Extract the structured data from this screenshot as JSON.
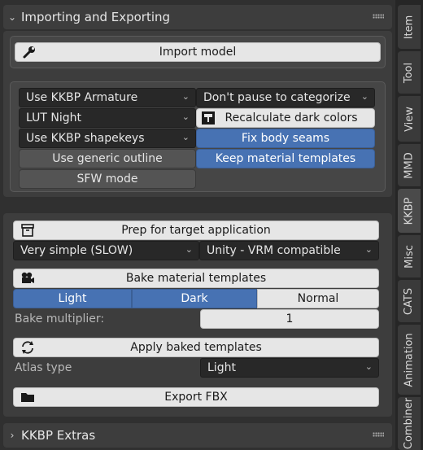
{
  "panel_title": "Importing and Exporting",
  "import_button": "Import model",
  "options": {
    "armature": "Use KKBP Armature",
    "categorize": "Don't pause to categorize",
    "lut": "LUT Night",
    "recalc_dark": "Recalculate dark colors",
    "shapekeys": "Use KKBP shapekeys",
    "fix_seams": "Fix body seams",
    "generic_outline": "Use generic outline",
    "keep_templates": "Keep material templates",
    "sfw": "SFW mode"
  },
  "export": {
    "prep_button": "Prep for target application",
    "simplify": "Very simple (SLOW)",
    "target": "Unity - VRM compatible",
    "bake_button": "Bake material templates",
    "bake_modes": [
      "Light",
      "Dark",
      "Normal"
    ],
    "bake_multiplier_label": "Bake multiplier:",
    "bake_multiplier_value": "1",
    "apply_button": "Apply baked templates",
    "atlas_label": "Atlas type",
    "atlas_value": "Light",
    "export_button": "Export FBX"
  },
  "extras_title": "KKBP Extras",
  "tabs": [
    "Item",
    "Tool",
    "View",
    "MMD",
    "KKBP",
    "Misc",
    "CATS",
    "Animation",
    "Combiner"
  ],
  "active_tab": "KKBP",
  "colors": {
    "accent_blue": "#4772b3",
    "panel_bg": "#3d3d3d",
    "dropdown_bg": "#282828"
  }
}
